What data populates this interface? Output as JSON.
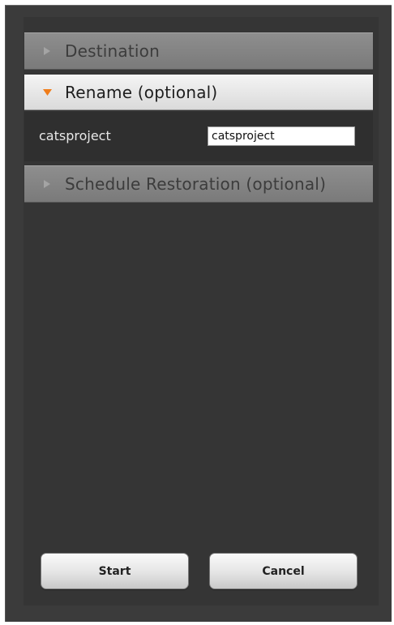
{
  "sections": {
    "destination": {
      "title": "Destination",
      "state": "collapsed"
    },
    "rename": {
      "title": "Rename (optional)",
      "state": "expanded",
      "field_label": "catsproject",
      "field_value": "catsproject"
    },
    "schedule": {
      "title": "Schedule Restoration (optional)",
      "state": "collapsed"
    }
  },
  "buttons": {
    "start_label": "Start",
    "cancel_label": "Cancel"
  },
  "colors": {
    "dialog_bg": "#3b3b3b",
    "collapsed_arrow": "#9a9a9a",
    "expanded_arrow": "#f07d1a"
  },
  "icons": {
    "collapsed": "triangle-right-icon",
    "expanded": "triangle-down-icon"
  }
}
